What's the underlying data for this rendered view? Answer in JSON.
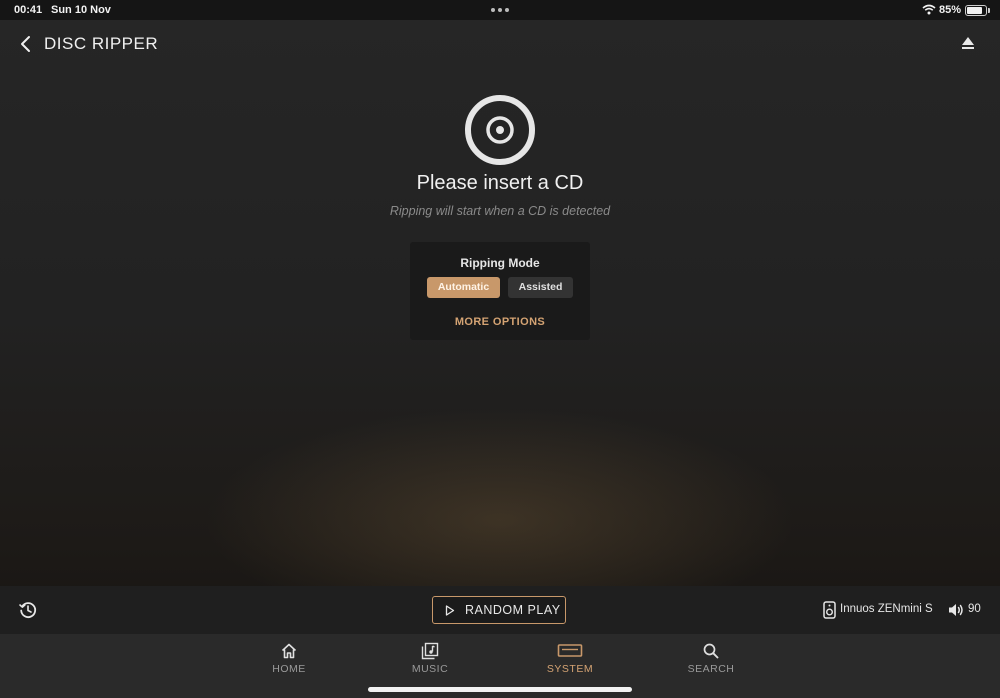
{
  "status_bar": {
    "time": "00:41",
    "date": "Sun 10 Nov",
    "battery_percent": "85%",
    "battery_level": 0.85
  },
  "header": {
    "title": "DISC RIPPER",
    "back_icon": "chevron-left-icon",
    "eject_icon": "eject-icon"
  },
  "main": {
    "disc_icon": "disc-icon",
    "prompt": "Please insert a CD",
    "hint": "Ripping will start when a CD is detected",
    "ripping_mode": {
      "title": "Ripping Mode",
      "options": [
        "Automatic",
        "Assisted"
      ],
      "selected": "Automatic"
    },
    "more_options": "MORE OPTIONS"
  },
  "player_bar": {
    "random_play": "RANDOM PLAY",
    "device_name": "Innuos ZENmini S",
    "volume": "90"
  },
  "tabs": [
    {
      "label": "HOME",
      "icon": "home-icon"
    },
    {
      "label": "MUSIC",
      "icon": "music-icon"
    },
    {
      "label": "SYSTEM",
      "icon": "system-icon",
      "active": true
    },
    {
      "label": "SEARCH",
      "icon": "search-icon"
    }
  ],
  "colors": {
    "accent": "#c8986a",
    "accent_text": "#d4a373",
    "background": "#222222"
  }
}
